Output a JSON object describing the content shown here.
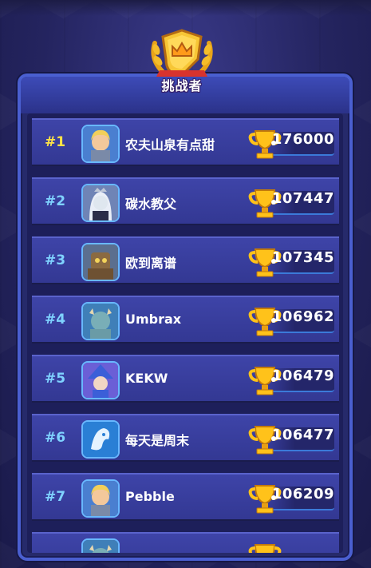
{
  "header": {
    "title": "挑战者"
  },
  "leaderboard": [
    {
      "rank": "#1",
      "name": "农夫山泉有点甜",
      "score": "176000",
      "avatar": "blonde-knight-avatar"
    },
    {
      "rank": "#2",
      "name": "碳水教父",
      "score": "107447",
      "avatar": "white-haired-queen-avatar"
    },
    {
      "rank": "#3",
      "name": "欧到离谱",
      "score": "107345",
      "avatar": "rusty-robot-avatar"
    },
    {
      "rank": "#4",
      "name": "Umbrax",
      "score": "106962",
      "avatar": "horned-giant-avatar"
    },
    {
      "rank": "#5",
      "name": "KEKW",
      "score": "106479",
      "avatar": "blue-wizard-avatar"
    },
    {
      "rank": "#6",
      "name": "每天是周末",
      "score": "106477",
      "avatar": "ice-dragon-avatar"
    },
    {
      "rank": "#7",
      "name": "Pebble",
      "score": "106209",
      "avatar": "blonde-knight-avatar"
    }
  ],
  "colors": {
    "rank_first": "#ffe347",
    "rank_other": "#7fd2ff",
    "panel_border": "#4a5fd0",
    "trophy_gold": "#ffc21a"
  },
  "icons": {
    "badge": "crown-shield-badge-icon",
    "trophy": "gold-trophy-icon"
  }
}
